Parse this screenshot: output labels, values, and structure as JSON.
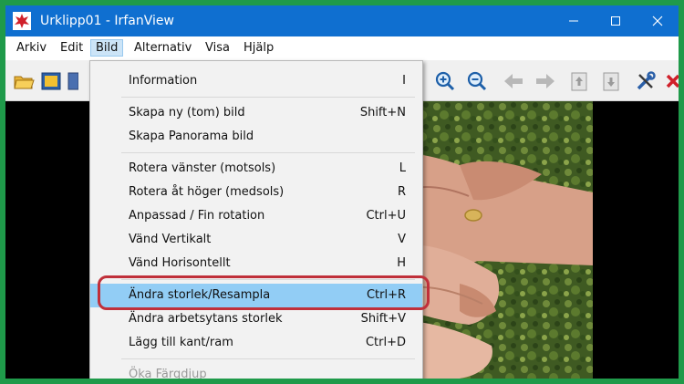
{
  "window": {
    "title": "Urklipp01 - IrfanView",
    "controls": {
      "minimize": "—",
      "maximize": "☐",
      "close": "✕"
    }
  },
  "menubar": {
    "items": [
      "Arkiv",
      "Edit",
      "Bild",
      "Alternativ",
      "Visa",
      "Hjälp"
    ],
    "active": "Bild"
  },
  "bild_menu": {
    "information": {
      "label": "Information",
      "shortcut": "I"
    },
    "group1": [
      {
        "label": "Skapa ny (tom) bild",
        "shortcut": "Shift+N"
      },
      {
        "label": "Skapa Panorama bild",
        "shortcut": ""
      }
    ],
    "group2": [
      {
        "label": "Rotera vänster (motsols)",
        "shortcut": "L"
      },
      {
        "label": "Rotera åt höger (medsols)",
        "shortcut": "R"
      },
      {
        "label": "Anpassad / Fin rotation",
        "shortcut": "Ctrl+U"
      },
      {
        "label": "Vänd Vertikalt",
        "shortcut": "V"
      },
      {
        "label": "Vänd Horisontellt",
        "shortcut": "H"
      }
    ],
    "group3": [
      {
        "label": "Ändra storlek/Resampla",
        "shortcut": "Ctrl+R",
        "highlighted": true
      },
      {
        "label": "Ändra arbetsytans storlek",
        "shortcut": "Shift+V"
      },
      {
        "label": "Lägg till kant/ram",
        "shortcut": "Ctrl+D"
      }
    ],
    "disabled": {
      "label": "Öka Färgdjup",
      "shortcut": ""
    }
  },
  "toolbar_icons": [
    "open-folder-icon",
    "slideshow-icon",
    "filmstrip-icon",
    "zoom-in-icon",
    "zoom-out-icon",
    "previous-icon",
    "next-icon",
    "first-page-icon",
    "last-page-icon",
    "settings-icon",
    "exit-icon"
  ],
  "colors": {
    "titlebar": "#0f6fd0",
    "menu_highlight": "#92cdf5",
    "annotation_ring": "#c0303a",
    "outer_border": "#1f9a4a"
  }
}
